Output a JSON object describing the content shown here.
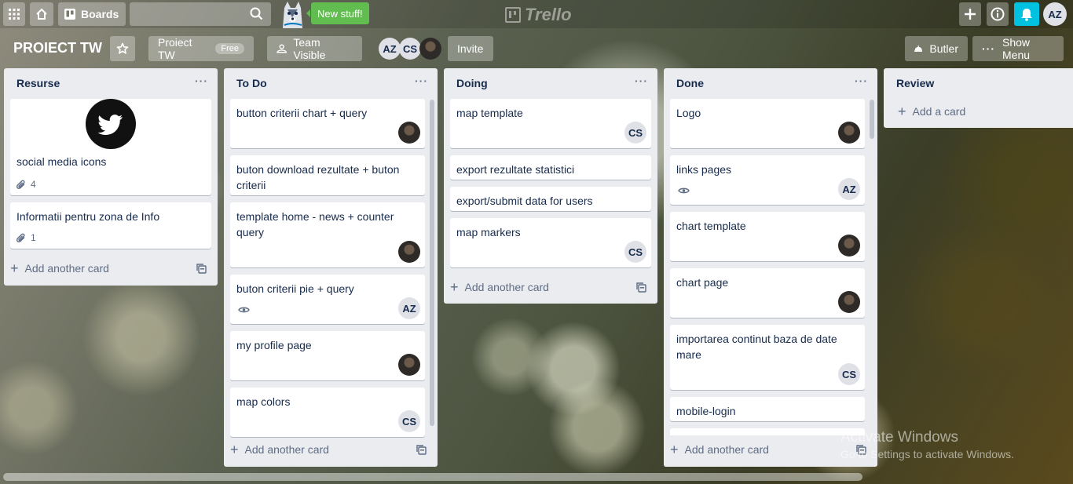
{
  "topbar": {
    "boards_label": "Boards",
    "new_stuff_label": "New stuff!",
    "logo_text": "Trello",
    "user_initials": "AZ"
  },
  "board": {
    "title": "PROIECT TW",
    "team_label": "Proiect TW",
    "free_badge": "Free",
    "visibility_label": "Team Visible",
    "invite_label": "Invite",
    "butler_label": "Butler",
    "show_menu_label": "Show Menu",
    "members": [
      "AZ",
      "CS"
    ]
  },
  "lists": {
    "resurse": {
      "title": "Resurse",
      "cards": [
        {
          "title": "social media icons",
          "attachments": "4"
        },
        {
          "title": "Informatii pentru zona de Info",
          "attachments": "1"
        }
      ],
      "add_label": "Add another card"
    },
    "todo": {
      "title": "To Do",
      "cards": [
        {
          "title": "button criterii chart + query"
        },
        {
          "title": "buton download rezultate + buton criterii"
        },
        {
          "title": "template home - news + counter query"
        },
        {
          "title": "buton criterii pie + query",
          "member": "AZ"
        },
        {
          "title": "my profile page"
        },
        {
          "title": "map colors",
          "member": "CS"
        }
      ],
      "add_label": "Add another card"
    },
    "doing": {
      "title": "Doing",
      "cards": [
        {
          "title": "map template",
          "member": "CS"
        },
        {
          "title": "export rezultate statistici"
        },
        {
          "title": "export/submit data for users"
        },
        {
          "title": "map markers",
          "member": "CS"
        }
      ],
      "add_label": "Add another card"
    },
    "done": {
      "title": "Done",
      "cards": [
        {
          "title": "Logo"
        },
        {
          "title": "links pages",
          "member": "AZ"
        },
        {
          "title": "chart template"
        },
        {
          "title": "chart page"
        },
        {
          "title": "importarea continut baza de date mare",
          "member": "CS"
        },
        {
          "title": "mobile-login"
        }
      ],
      "add_label": "Add another card"
    },
    "review": {
      "title": "Review",
      "add_label": "Add a card"
    }
  },
  "watermark": {
    "line1": "Activate Windows",
    "line2": "Go to Settings to activate Windows."
  },
  "colors": {
    "list_bg": "#ebecf0",
    "new_stuff": "#61bd4f",
    "notification": "#00c2e0"
  }
}
